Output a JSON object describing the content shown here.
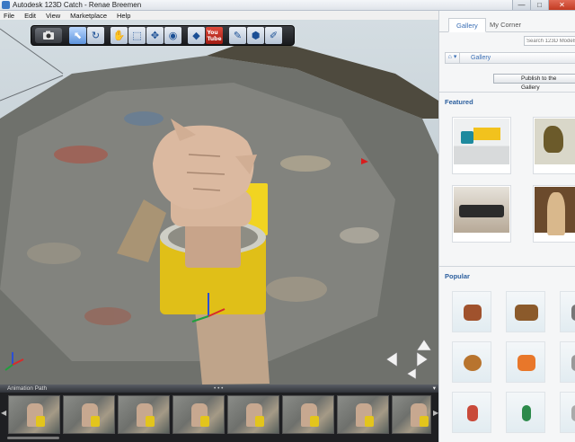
{
  "window": {
    "title": "Autodesk 123D Catch - Renae Breemen",
    "controls": [
      "—",
      "□",
      "✕"
    ]
  },
  "menu": [
    "File",
    "Edit",
    "View",
    "Marketplace",
    "Help"
  ],
  "toolbar": {
    "camera_icon": "camera-icon",
    "tools": [
      {
        "name": "select-icon",
        "glyph": "⬉",
        "active": true
      },
      {
        "name": "lasso-icon",
        "glyph": "↻"
      },
      {
        "name": "pan-hand-icon",
        "glyph": "✋"
      },
      {
        "name": "selection-box-icon",
        "glyph": "⬚"
      },
      {
        "name": "orbit-icon",
        "glyph": "✥"
      },
      {
        "name": "camera-view-icon",
        "glyph": "◉"
      },
      {
        "name": "render-icon",
        "glyph": "◆"
      },
      {
        "name": "youtube-icon",
        "glyph": "You Tube"
      },
      {
        "name": "pen-tool-icon",
        "glyph": "✎"
      },
      {
        "name": "export-icon",
        "glyph": "⬢"
      },
      {
        "name": "notes-icon",
        "glyph": "✐"
      }
    ]
  },
  "animation": {
    "header": "Animation Path",
    "handle": "• • •",
    "frame_count": 8
  },
  "panel": {
    "tabs": [
      "Gallery",
      "My Corner"
    ],
    "search_placeholder": "Search 123D Models",
    "breadcrumb": {
      "home": "⌂ ▾",
      "item": "Gallery"
    },
    "publish_label": "Publish to the Gallery",
    "featured_title": "Featured",
    "popular_title": "Popular"
  },
  "colors": {
    "accent": "#2c5f9e",
    "link": "#3b6fb5",
    "close": "#c23a22",
    "tin": "#e3c51c"
  }
}
